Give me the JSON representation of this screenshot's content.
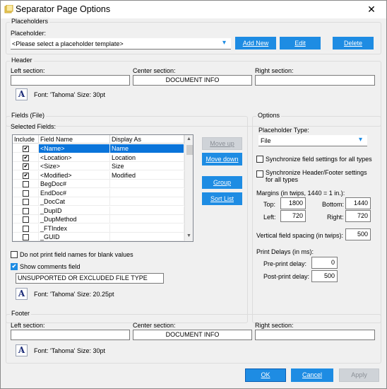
{
  "window": {
    "title": "Separator Page Options",
    "close_glyph": "✕"
  },
  "placeholders": {
    "group_label": "Placeholders",
    "field_label": "Placeholder:",
    "select_value": "<Please select a placeholder template>",
    "add_new": "Add New",
    "edit": "Edit",
    "delete": "Delete"
  },
  "header": {
    "group_label": "Header",
    "left_label": "Left section:",
    "center_label": "Center section:",
    "right_label": "Right section:",
    "left_value": "",
    "center_value": "DOCUMENT INFO",
    "right_value": "",
    "font_text": "Font: 'Tahoma' Size: 30pt"
  },
  "fields": {
    "group_label": "Fields (File)",
    "selected_label": "Selected Fields:",
    "columns": [
      "Include",
      "Field Name",
      "Display As"
    ],
    "rows": [
      {
        "checked": true,
        "name": "<Name>",
        "display": "Name",
        "selected": true
      },
      {
        "checked": true,
        "name": "<Location>",
        "display": "Location",
        "selected": false
      },
      {
        "checked": true,
        "name": "<Size>",
        "display": "Size",
        "selected": false
      },
      {
        "checked": true,
        "name": "<Modified>",
        "display": "Modified",
        "selected": false
      },
      {
        "checked": false,
        "name": "BegDoc#",
        "display": "",
        "selected": false
      },
      {
        "checked": false,
        "name": "EndDoc#",
        "display": "",
        "selected": false
      },
      {
        "checked": false,
        "name": "_DocCat",
        "display": "",
        "selected": false
      },
      {
        "checked": false,
        "name": "_DupID",
        "display": "",
        "selected": false
      },
      {
        "checked": false,
        "name": "_DupMethod",
        "display": "",
        "selected": false
      },
      {
        "checked": false,
        "name": "_FTIndex",
        "display": "",
        "selected": false
      },
      {
        "checked": false,
        "name": "_GUID",
        "display": "",
        "selected": false
      }
    ],
    "move_up": "Move up",
    "move_down": "Move down",
    "group": "Group",
    "sort_list": "Sort List",
    "no_print_blank": "Do not print field names for blank values",
    "no_print_blank_checked": false,
    "show_comments": "Show comments field",
    "show_comments_checked": true,
    "comments_value": "UNSUPPORTED OR EXCLUDED FILE TYPE",
    "font_text": "Font: 'Tahoma' Size: 20.25pt"
  },
  "options": {
    "group_label": "Options",
    "type_label": "Placeholder Type:",
    "type_value": "File",
    "sync_fields": "Synchronize field settings for all types",
    "sync_fields_checked": false,
    "sync_header": "Synchronize Header/Footer settings for all types",
    "sync_header_checked": false,
    "margins_label": "Margins (in twips, 1440 = 1 in.):",
    "top_label": "Top:",
    "top_value": "1800",
    "bottom_label": "Bottom:",
    "bottom_value": "1440",
    "left_label": "Left:",
    "left_value": "720",
    "right_label": "Right:",
    "right_value": "720",
    "spacing_label": "Vertical field spacing (in twips):",
    "spacing_value": "500",
    "delays_label": "Print Delays (in ms):",
    "pre_label": "Pre-print delay:",
    "pre_value": "0",
    "post_label": "Post-print delay:",
    "post_value": "500"
  },
  "footer": {
    "group_label": "Footer",
    "left_label": "Left section:",
    "center_label": "Center section:",
    "right_label": "Right section:",
    "left_value": "",
    "center_value": "DOCUMENT INFO",
    "right_value": "",
    "font_text": "Font: 'Tahoma' Size: 30pt"
  },
  "dialog": {
    "ok": "OK",
    "cancel": "Cancel",
    "apply": "Apply"
  },
  "icons": {
    "font_glyph": "A",
    "check_glyph": "✔",
    "dropdown_glyph": "▾"
  },
  "colors": {
    "accent": "#1e8ce3",
    "selection": "#0a74da"
  }
}
